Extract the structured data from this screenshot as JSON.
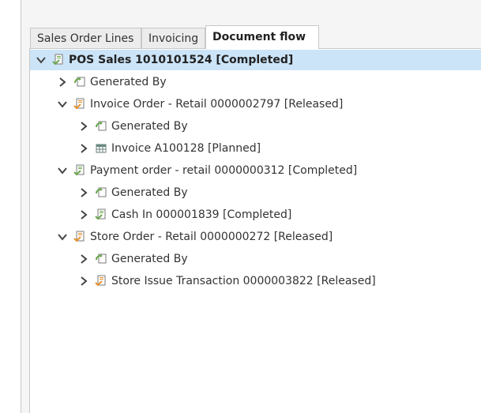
{
  "tabs": [
    {
      "label": "Sales Order Lines"
    },
    {
      "label": "Invoicing"
    },
    {
      "label": "Document flow"
    }
  ],
  "tree": {
    "root": {
      "label": "POS Sales 1010101524 [Completed]",
      "icon": "document-completed-icon"
    },
    "root_children": {
      "generated_by": {
        "label": "Generated By",
        "icon": "generated-by-icon"
      },
      "invoice_order": {
        "label": "Invoice Order - Retail 0000002797 [Released]",
        "icon": "document-released-icon"
      },
      "invoice_order_children": {
        "generated_by": {
          "label": "Generated By",
          "icon": "generated-by-icon"
        },
        "invoice": {
          "label": "Invoice A100128 [Planned]",
          "icon": "invoice-grid-icon"
        }
      },
      "payment_order": {
        "label": "Payment order - retail 0000000312 [Completed]",
        "icon": "document-completed-icon"
      },
      "payment_order_children": {
        "generated_by": {
          "label": "Generated By",
          "icon": "generated-by-icon"
        },
        "cash_in": {
          "label": "Cash In 000001839 [Completed]",
          "icon": "document-completed-icon"
        }
      },
      "store_order": {
        "label": "Store Order - Retail 0000000272 [Released]",
        "icon": "document-released-icon"
      },
      "store_order_children": {
        "generated_by": {
          "label": "Generated By",
          "icon": "generated-by-icon"
        },
        "store_issue": {
          "label": "Store Issue Transaction 0000003822 [Released]",
          "icon": "document-released-icon"
        }
      }
    }
  },
  "colors": {
    "selection": "#cce4f7",
    "released_accent": "#e8912b",
    "completed_accent": "#6aa84f"
  }
}
